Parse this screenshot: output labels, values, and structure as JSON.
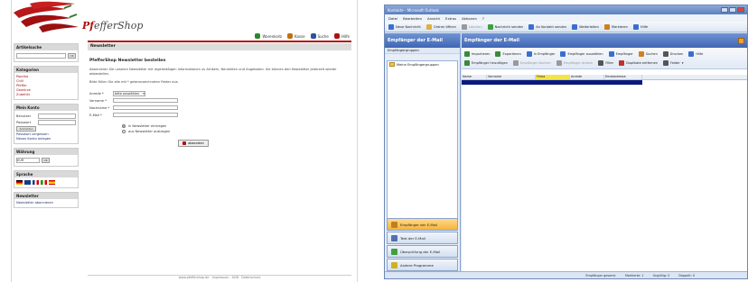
{
  "shop": {
    "logo_prefix": "Pf",
    "logo_main": "efferShop",
    "topnav": [
      {
        "label": "Warenkorb",
        "icon": "cart-icon",
        "color": "#2a8a2a"
      },
      {
        "label": "Kasse",
        "icon": "checkout-icon",
        "color": "#c07010"
      },
      {
        "label": "Suche",
        "icon": "search-icon",
        "color": "#3050a0"
      },
      {
        "label": "Hilfe",
        "icon": "help-icon",
        "color": "#b01010"
      }
    ],
    "sidebar": {
      "search": {
        "title": "Artikelsuche",
        "button": "OK"
      },
      "categories": {
        "title": "Kategorien",
        "items": [
          "Paprika",
          "Chili",
          "Pfeffer",
          "Gewürze",
          "Zubehör"
        ]
      },
      "login": {
        "title": "Mein Konto",
        "fields": [
          "Benutzer",
          "Passwort"
        ],
        "button": "Anmelden",
        "links": [
          "Passwort vergessen",
          "Neues Konto anlegen"
        ]
      },
      "currency": {
        "title": "Währung",
        "value": "EUR"
      },
      "language": {
        "title": "Sprache"
      },
      "newsletter": {
        "title": "Newsletter",
        "link": "Newsletter abonnieren"
      }
    },
    "content": {
      "header": "Newsletter",
      "title": "PfefferShop Newsletter bestellen",
      "intro": "Abonnieren Sie unseren Newsletter mit regelmäßigen Informationen zu Artikeln, Neuheiten und Angeboten. Sie können den Newsletter jederzeit wieder abbestellen.",
      "required_note": "Bitte füllen Sie alle mit * gekennzeichneten Felder aus.",
      "fields": {
        "salutation_label": "Anrede *",
        "salutation_value": "bitte auswählen",
        "firstname_label": "Vorname *",
        "lastname_label": "Nachname *",
        "email_label": "E-Mail *"
      },
      "radio_subscribe": "in Newsletter eintragen",
      "radio_unsubscribe": "aus Newsletter austragen",
      "submit": "absenden"
    },
    "footer": "www.pfeffershop.de · Impressum · AGB · Datenschutz"
  },
  "outlook": {
    "title": "Kontakte - Microsoft Outlook",
    "menus": [
      "Datei",
      "Bearbeiten",
      "Ansicht",
      "Extras",
      "Aktionen",
      "?"
    ],
    "toolbar": [
      {
        "label": "Neue Nachricht",
        "icon": "new-mail-icon",
        "color": "#3a6fd0"
      },
      {
        "label": "Ordner öffnen",
        "icon": "folder-icon",
        "color": "#e0b040"
      },
      {
        "label": "Löschen",
        "icon": "delete-icon",
        "color": "#999999",
        "disabled": true
      },
      {
        "label": "Nachricht senden",
        "icon": "send-icon",
        "color": "#40a040"
      },
      {
        "label": "An Kontakt senden",
        "icon": "contact-icon",
        "color": "#3a6fd0"
      },
      {
        "label": "Weiterleiten",
        "icon": "forward-icon",
        "color": "#3a6fd0"
      },
      {
        "label": "Markieren",
        "icon": "flag-icon",
        "color": "#d08020"
      },
      {
        "label": "Hilfe",
        "icon": "help-icon",
        "color": "#3a6fd0"
      }
    ],
    "nav": {
      "header": "Empfänger der E-Mail",
      "folder_header": "Empfängergruppen",
      "folders": [
        "Meine Empfängergruppen"
      ],
      "buttons": [
        {
          "label": "Empfänger der E-Mail",
          "icon": "recipients-icon",
          "color": "#c08020",
          "active": true
        },
        {
          "label": "Text der E-Mail",
          "icon": "text-icon",
          "color": "#5070b0"
        },
        {
          "label": "Überprüfung der E-Mail",
          "icon": "check-icon",
          "color": "#40a040"
        },
        {
          "label": "Andere Programme",
          "icon": "programs-icon",
          "color": "#d0b020"
        }
      ]
    },
    "main": {
      "header": "Empfänger der E-Mail",
      "toolbar": [
        {
          "label": "Importieren",
          "icon": "import-icon",
          "color": "#3a8a3a"
        },
        {
          "label": "Exportieren",
          "icon": "export-icon",
          "color": "#3a8a3a"
        },
        {
          "label": "In Empfänger",
          "icon": "recipient-icon",
          "color": "#3a6fd0"
        },
        {
          "label": "Empfänger auswählen",
          "icon": "select-icon",
          "color": "#3a6fd0"
        },
        {
          "label": "Empfänger",
          "icon": "recipients-icon",
          "color": "#3a6fd0"
        },
        {
          "label": "Suchen",
          "icon": "search-icon",
          "color": "#d08020"
        },
        {
          "label": "Drucken",
          "icon": "print-icon",
          "color": "#555555"
        },
        {
          "label": "Hilfe",
          "icon": "help-icon",
          "color": "#3a6fd0"
        },
        {
          "label": "Empfänger hinzufügen",
          "icon": "add-icon",
          "color": "#3a8a3a"
        },
        {
          "label": "Empfänger löschen",
          "icon": "remove-icon",
          "color": "#999999",
          "disabled": true
        },
        {
          "label": "Empfänger ändern",
          "icon": "edit-icon",
          "color": "#999999",
          "disabled": true
        },
        {
          "label": "Filter",
          "icon": "filter-icon",
          "color": "#555555"
        },
        {
          "label": "Duplikate entfernen",
          "icon": "duplicates-icon",
          "color": "#c03030"
        },
        {
          "label": "Felder",
          "icon": "fields-icon",
          "color": "#555555"
        }
      ],
      "columns": [
        "Name",
        "Vorname",
        "Firma",
        "Anrede",
        "Emailadresse"
      ]
    },
    "status": [
      "Empfänger gesamt:",
      "Markierte: 1",
      "Ungültig: 0",
      "Doppelt: 0"
    ]
  }
}
